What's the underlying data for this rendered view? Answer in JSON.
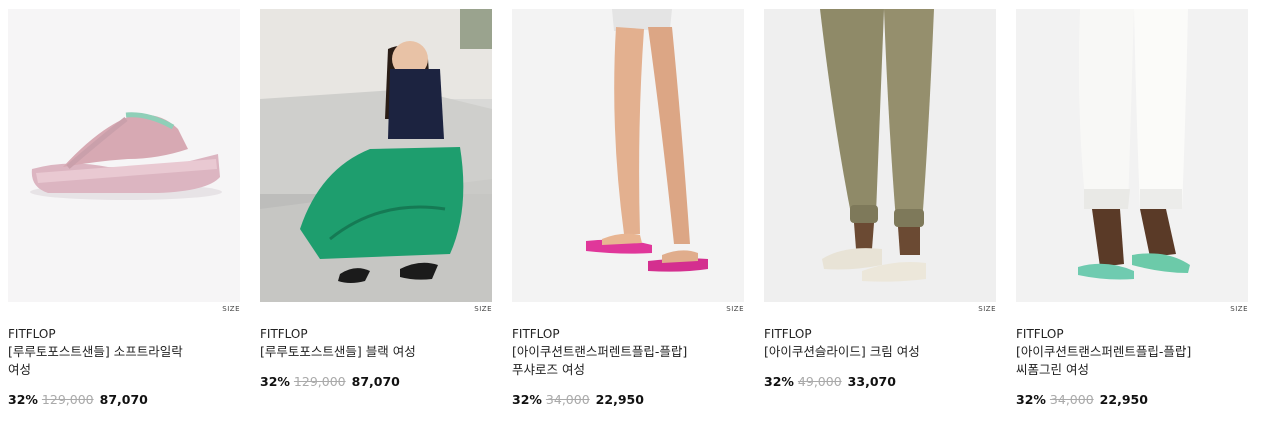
{
  "size_label": "SIZE",
  "products": [
    {
      "brand": "FITFLOP",
      "name_line1": "[루루토포스트샌들] 소프트라일락",
      "name_line2": "여성",
      "discount": "32%",
      "original_price": "129,000",
      "sale_price": "87,070",
      "image": "lilac-sandal-product-photo"
    },
    {
      "brand": "FITFLOP",
      "name_line1": "[루루토포스트샌들] 블랙 여성",
      "name_line2": "",
      "discount": "32%",
      "original_price": "129,000",
      "sale_price": "87,070",
      "image": "model-green-skirt-photo"
    },
    {
      "brand": "FITFLOP",
      "name_line1": "[아이쿠션트랜스퍼렌트플립-플랍]",
      "name_line2": "푸샤로즈 여성",
      "discount": "32%",
      "original_price": "34,000",
      "sale_price": "22,950",
      "image": "pink-flipflop-legs-photo"
    },
    {
      "brand": "FITFLOP",
      "name_line1": "[아이쿠션슬라이드] 크림 여성",
      "name_line2": "",
      "discount": "32%",
      "original_price": "49,000",
      "sale_price": "33,070",
      "image": "cream-slide-jogger-photo"
    },
    {
      "brand": "FITFLOP",
      "name_line1": "[아이쿠션트랜스퍼렌트플립-플랍]",
      "name_line2": "씨폼그린 여성",
      "discount": "32%",
      "original_price": "34,000",
      "sale_price": "22,950",
      "image": "green-flipflop-white-pants-photo"
    }
  ]
}
